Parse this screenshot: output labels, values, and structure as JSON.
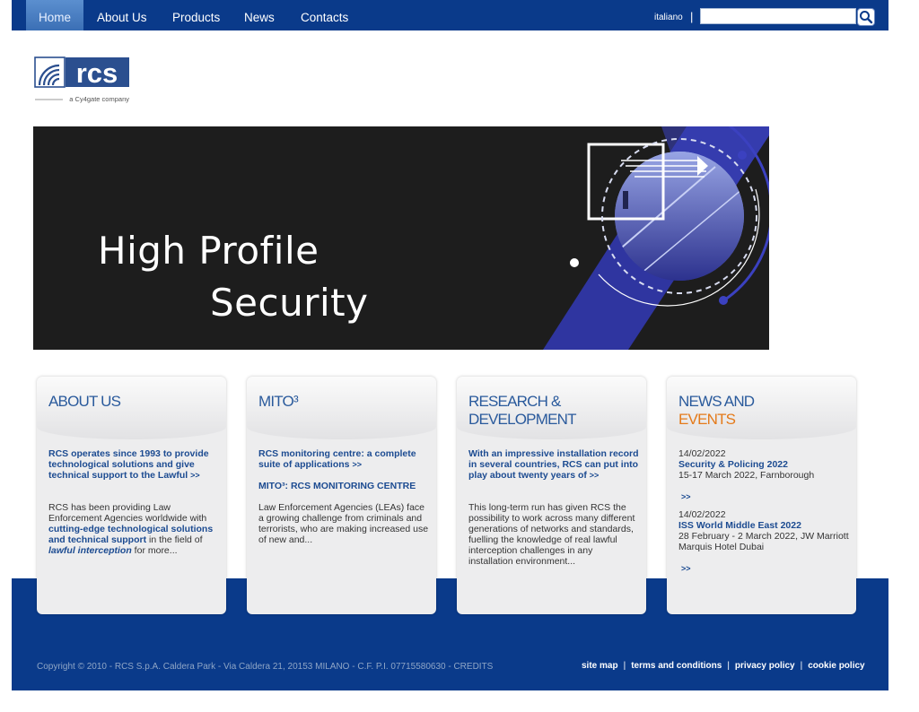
{
  "nav": {
    "items": [
      "Home",
      "About Us",
      "Products",
      "News",
      "Contacts"
    ],
    "language": "italiano",
    "search_value": "",
    "search_icon": "search-icon"
  },
  "logo": {
    "brand": "rcs",
    "tagline": "a Cy4gate company"
  },
  "hero": {
    "line1": "High Profile",
    "line2": "Security"
  },
  "colors": {
    "nav_blue": "#0a3a8a",
    "title_blue": "#2a5a9c",
    "link_blue": "#1c4b91",
    "accent_orange": "#e47a1a"
  },
  "cards": {
    "about": {
      "title": "ABOUT US",
      "lead": "RCS operates since 1993 to provide technological solutions and give technical support to the Lawful",
      "more": ">>",
      "text_part1": "RCS has been providing Law Enforcement Agencies worldwide with ",
      "highlight": "cutting-edge technological solutions and technical support",
      "text_part2": " in the field of ",
      "emphasis": "lawful interception",
      "text_part3": " for more..."
    },
    "mito": {
      "title": "MITO³",
      "lead": "RCS monitoring centre: a complete suite of applications",
      "more": ">>",
      "subheading": "MITO³: RCS MONITORING CENTRE",
      "text": "Law Enforcement Agencies (LEAs) face a growing challenge from criminals and terrorists, who are making increased use of new and..."
    },
    "research": {
      "title_line1": "RESEARCH &",
      "title_line2": "DEVELOPMENT",
      "lead": "With an impressive installation record in several countries, RCS can put into play about twenty years of",
      "more": ">>",
      "text": "This long-term run has given RCS the possibility to work across many different generations of networks and standards, fuelling the knowledge of real lawful interception challenges in any installation environment..."
    },
    "news": {
      "title_line1": "NEWS AND",
      "title_line2": "EVENTS",
      "events": [
        {
          "date": "14/02/2022",
          "title": "Security & Policing 2022",
          "detail": "15-17 March 2022, Farnborough",
          "more": ">>"
        },
        {
          "date": "14/02/2022",
          "title": "ISS World Middle East 2022",
          "detail": "28 February - 2 March 2022, JW Marriott Marquis Hotel Dubai",
          "more": ">>"
        }
      ]
    }
  },
  "footer": {
    "copyright": "Copyright © 2010 - RCS S.p.A. Caldera Park - Via Caldera 21, 20153 MILANO - C.F. P.I. 07715580630 - CREDITS",
    "links": [
      "site map",
      "terms and conditions",
      "privacy policy",
      "cookie policy"
    ]
  }
}
